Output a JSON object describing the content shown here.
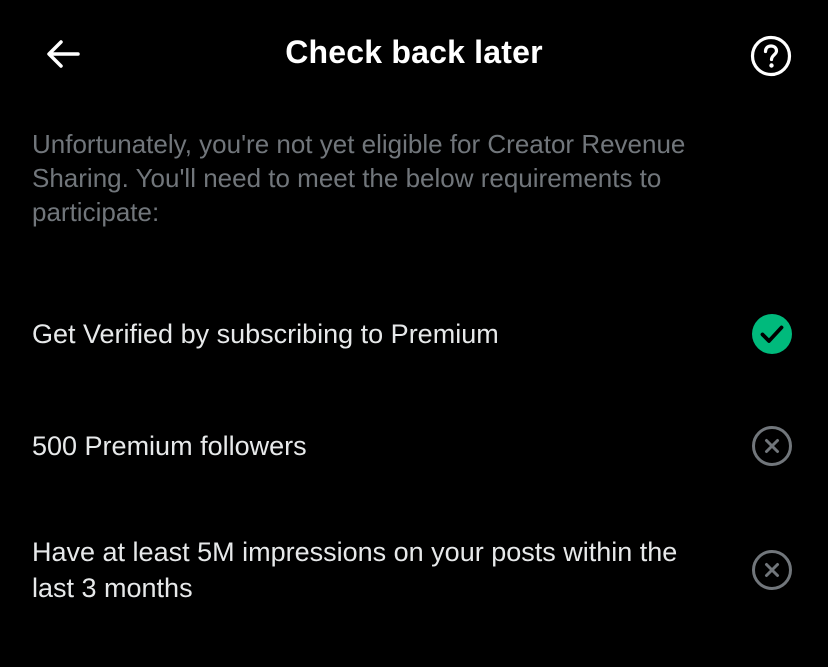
{
  "header": {
    "title": "Check back later",
    "back_icon": "arrow-left-icon",
    "help_icon": "question-circle-icon"
  },
  "intro_text": "Unfortunately, you're not yet eligible for Creator Revenue Sharing. You'll need to meet the below requirements to participate:",
  "requirements": [
    {
      "label": "Get Verified by subscribing to Premium",
      "status": "met",
      "icon": "check-circle-icon"
    },
    {
      "label": "500 Premium followers",
      "status": "not-met",
      "icon": "x-circle-icon"
    },
    {
      "label": "Have at least 5M impressions on your posts within the last 3 months",
      "status": "not-met",
      "icon": "x-circle-icon"
    }
  ],
  "colors": {
    "background": "#000000",
    "primary_text": "#e7e9ea",
    "secondary_text": "#71767b",
    "success": "#00ba7c",
    "inactive_icon": "#71767b"
  }
}
